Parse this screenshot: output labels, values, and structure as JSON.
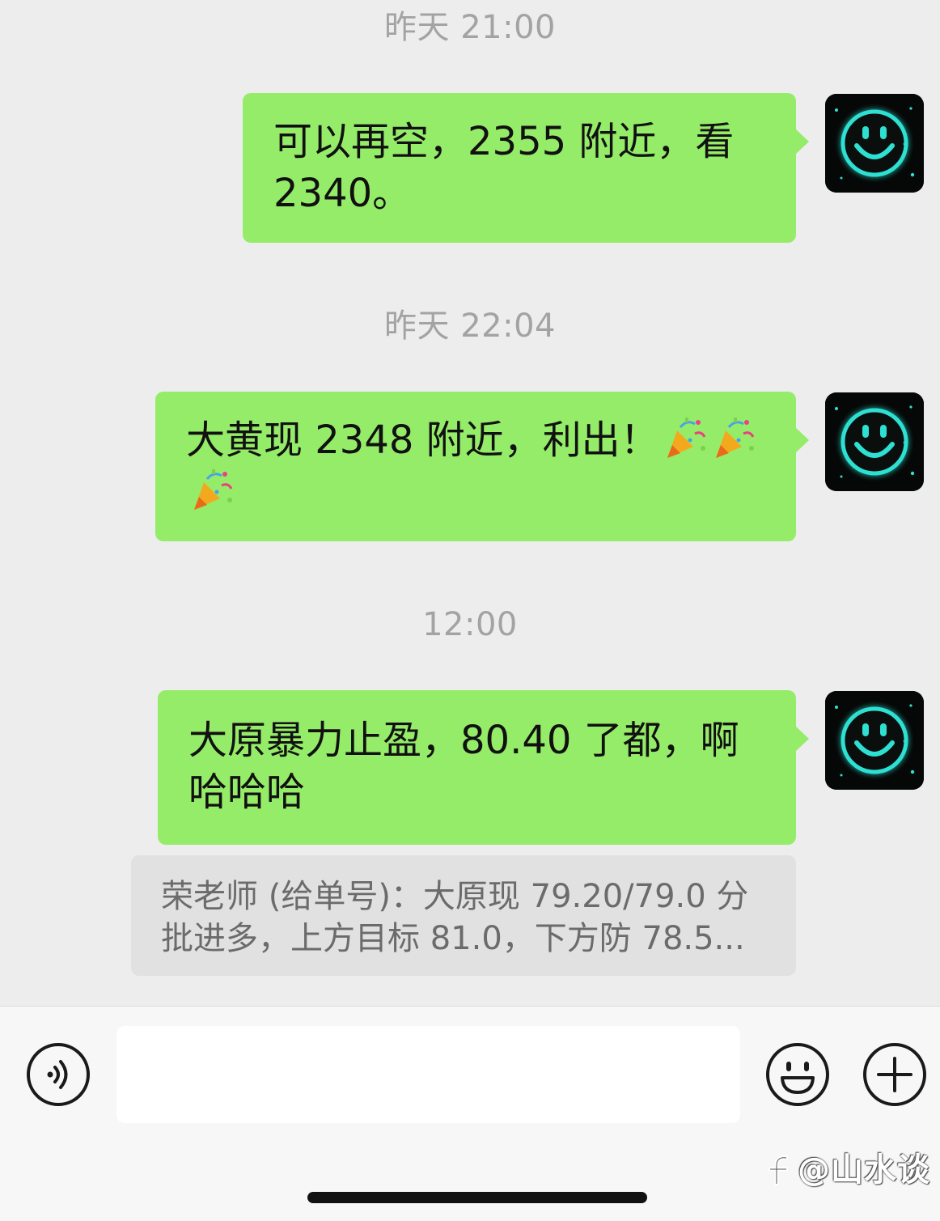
{
  "chat": {
    "messages": [
      {
        "timestamp": "昨天 21:00",
        "text": "可以再空，2355 附近，看 2340。",
        "emoji_count": 0
      },
      {
        "timestamp": "昨天 22:04",
        "text": "大黄现 2348 附近，利出！",
        "emoji": "🎉",
        "emoji_count": 3
      },
      {
        "timestamp": "12:00",
        "text": "大原暴力止盈，80.40 了都，啊哈哈哈",
        "emoji_count": 0
      }
    ],
    "quote": {
      "text": "荣老师 (给单号)：大原现 79.20/79.0 分批进多，上方目标 81.0，下方防 78.5..."
    },
    "avatar_icon": "smiley-face-icon"
  },
  "input_bar": {
    "voice_icon": "voice-icon",
    "emoji_icon": "emoji-face-icon",
    "add_icon": "plus-icon",
    "input_value": "",
    "input_placeholder": ""
  },
  "watermark": {
    "text": "@山水谈",
    "logo_icon": "platform-logo-icon"
  },
  "colors": {
    "chat_background": "#ededed",
    "sent_bubble": "#95ec69",
    "quote_bubble": "#e1e1e1",
    "timestamp": "#a3a3a3",
    "quote_text": "#6b6b6b",
    "input_bar": "#f7f7f7",
    "avatar_glow": "#2de0d2"
  }
}
